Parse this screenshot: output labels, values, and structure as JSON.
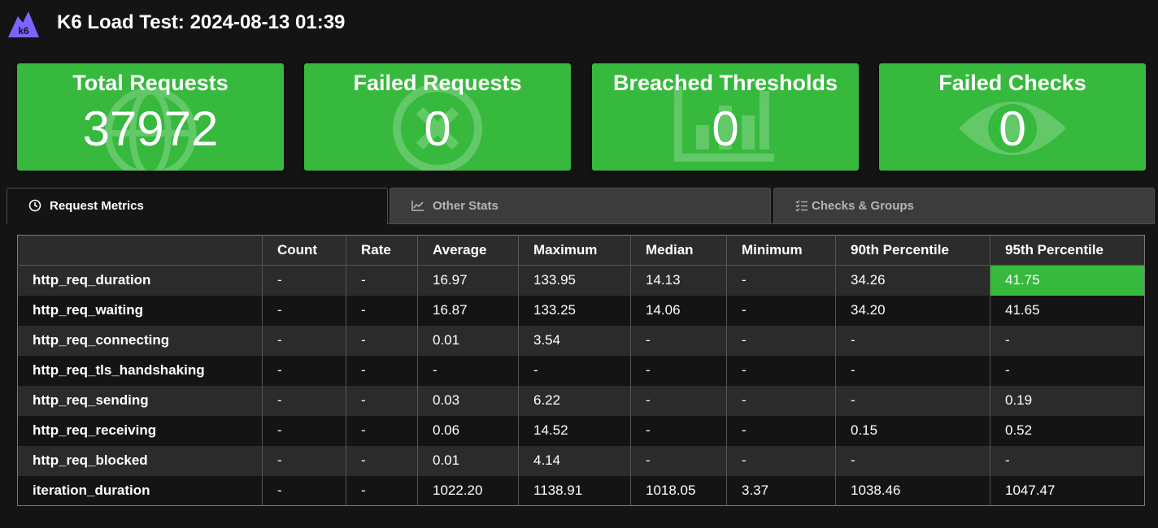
{
  "header": {
    "title": "K6 Load Test: 2024-08-13 01:39",
    "logo_text": "k6"
  },
  "colors": {
    "card_green": "#36b93d",
    "highlight_green": "#36b93d",
    "logo_purple": "#7d64ff",
    "background": "#141414"
  },
  "cards": [
    {
      "title": "Total Requests",
      "value": "37972",
      "icon": "globe-icon"
    },
    {
      "title": "Failed Requests",
      "value": "0",
      "icon": "circle-x-icon"
    },
    {
      "title": "Breached Thresholds",
      "value": "0",
      "icon": "bar-chart-icon"
    },
    {
      "title": "Failed Checks",
      "value": "0",
      "icon": "eye-icon"
    }
  ],
  "tabs": [
    {
      "label": "Request Metrics",
      "icon": "clock-icon",
      "active": true
    },
    {
      "label": "Other Stats",
      "icon": "line-chart-icon",
      "active": false
    },
    {
      "label": "Checks & Groups",
      "icon": "checklist-icon",
      "active": false
    }
  ],
  "table": {
    "columns": [
      "",
      "Count",
      "Rate",
      "Average",
      "Maximum",
      "Median",
      "Minimum",
      "90th Percentile",
      "95th Percentile"
    ],
    "rows": [
      {
        "name": "http_req_duration",
        "values": [
          "-",
          "-",
          "16.97",
          "133.95",
          "14.13",
          "-",
          "34.26",
          "41.75"
        ]
      },
      {
        "name": "http_req_waiting",
        "values": [
          "-",
          "-",
          "16.87",
          "133.25",
          "14.06",
          "-",
          "34.20",
          "41.65"
        ]
      },
      {
        "name": "http_req_connecting",
        "values": [
          "-",
          "-",
          "0.01",
          "3.54",
          "-",
          "-",
          "-",
          "-"
        ]
      },
      {
        "name": "http_req_tls_handshaking",
        "values": [
          "-",
          "-",
          "-",
          "-",
          "-",
          "-",
          "-",
          "-"
        ]
      },
      {
        "name": "http_req_sending",
        "values": [
          "-",
          "-",
          "0.03",
          "6.22",
          "-",
          "-",
          "-",
          "0.19"
        ]
      },
      {
        "name": "http_req_receiving",
        "values": [
          "-",
          "-",
          "0.06",
          "14.52",
          "-",
          "-",
          "0.15",
          "0.52"
        ]
      },
      {
        "name": "http_req_blocked",
        "values": [
          "-",
          "-",
          "0.01",
          "4.14",
          "-",
          "-",
          "-",
          "-"
        ]
      },
      {
        "name": "iteration_duration",
        "values": [
          "-",
          "-",
          "1022.20",
          "1138.91",
          "1018.05",
          "3.37",
          "1038.46",
          "1047.47"
        ]
      }
    ],
    "highlighted_cell": {
      "row": "http_req_duration",
      "column": "95th Percentile"
    }
  }
}
